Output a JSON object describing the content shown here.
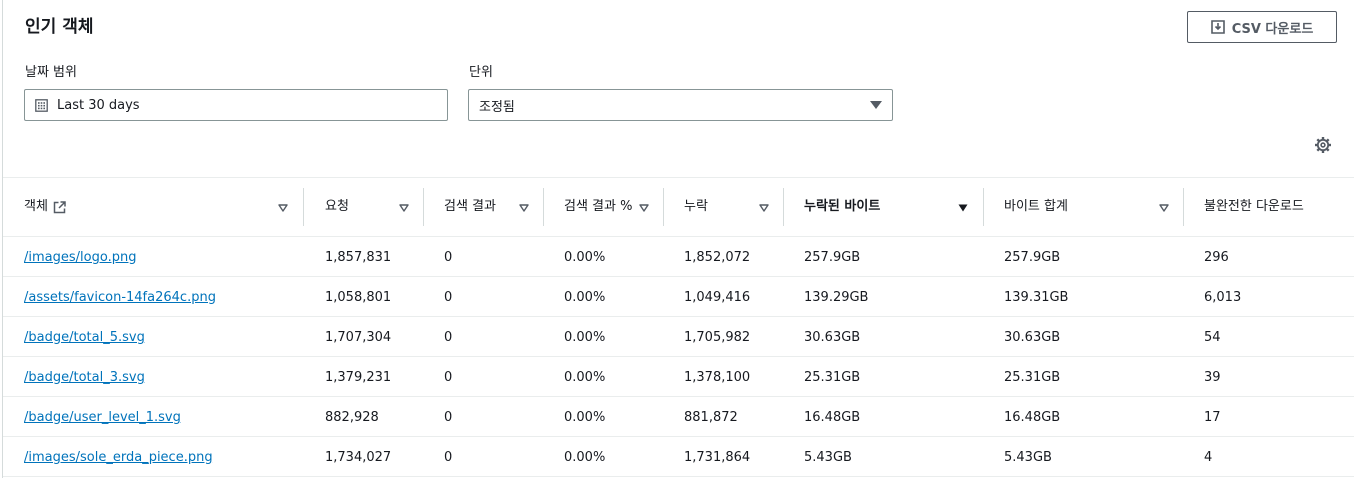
{
  "header": {
    "title": "인기 객체",
    "csv_button": "CSV 다운로드"
  },
  "filters": {
    "date_label": "날짜 범위",
    "date_value": "Last 30 days",
    "unit_label": "단위",
    "unit_value": "조정됨"
  },
  "table": {
    "columns": [
      "객체",
      "요청",
      "검색 결과",
      "검색 결과 %",
      "누락",
      "누락된 바이트",
      "바이트 합계",
      "불완전한 다운로드"
    ],
    "sorted_column": "누락된 바이트",
    "rows": [
      [
        "/images/logo.png",
        "1,857,831",
        "0",
        "0.00%",
        "1,852,072",
        "257.9GB",
        "257.9GB",
        "296"
      ],
      [
        "/assets/favicon-14fa264c.png",
        "1,058,801",
        "0",
        "0.00%",
        "1,049,416",
        "139.29GB",
        "139.31GB",
        "6,013"
      ],
      [
        "/badge/total_5.svg",
        "1,707,304",
        "0",
        "0.00%",
        "1,705,982",
        "30.63GB",
        "30.63GB",
        "54"
      ],
      [
        "/badge/total_3.svg",
        "1,379,231",
        "0",
        "0.00%",
        "1,378,100",
        "25.31GB",
        "25.31GB",
        "39"
      ],
      [
        "/badge/user_level_1.svg",
        "882,928",
        "0",
        "0.00%",
        "881,872",
        "16.48GB",
        "16.48GB",
        "17"
      ],
      [
        "/images/sole_erda_piece.png",
        "1,734,027",
        "0",
        "0.00%",
        "1,731,864",
        "5.43GB",
        "5.43GB",
        "4"
      ]
    ]
  }
}
